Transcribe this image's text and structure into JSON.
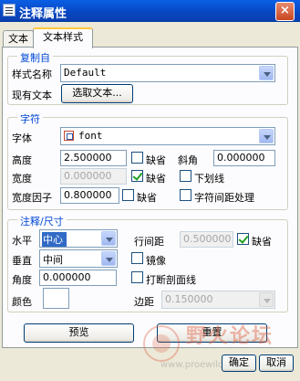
{
  "window": {
    "title": "注释属性",
    "close_symbol": "×"
  },
  "tabs": [
    {
      "label": "文本"
    },
    {
      "label": "文本样式"
    }
  ],
  "copy_from": {
    "group_title": "复制自",
    "style_name_label": "样式名称",
    "style_name_value": "Default",
    "existing_text_label": "现有文本",
    "select_text_button": "选取文本..."
  },
  "character": {
    "group_title": "字符",
    "font_label": "字体",
    "font_value": "font",
    "height_label": "高度",
    "height_value": "2.500000",
    "height_default_label": "缺省",
    "height_default_checked": false,
    "slant_label": "斜角",
    "slant_value": "0.000000",
    "width_label": "宽度",
    "width_value": "0.000000",
    "width_default_label": "缺省",
    "width_default_checked": true,
    "underline_label": "下划线",
    "underline_checked": false,
    "width_factor_label": "宽度因子",
    "width_factor_value": "0.800000",
    "width_factor_default_label": "缺省",
    "width_factor_default_checked": false,
    "char_spacing_label": "字符间距处理",
    "char_spacing_checked": false
  },
  "note_dim": {
    "group_title": "注释/尺寸",
    "horizontal_label": "水平",
    "horizontal_value": "中心",
    "vertical_label": "垂直",
    "vertical_value": "中间",
    "angle_label": "角度",
    "angle_value": "0.000000",
    "color_label": "颜色",
    "color_value": "#FFFFFF",
    "line_spacing_label": "行间距",
    "line_spacing_value": "0.500000",
    "line_spacing_default_label": "缺省",
    "line_spacing_default_checked": true,
    "mirror_label": "镜像",
    "mirror_checked": false,
    "break_hatch_label": "打断剖面线",
    "break_hatch_checked": false,
    "margin_label": "边距",
    "margin_value": "0.150000"
  },
  "buttons": {
    "preview": "预览",
    "reset": "重置",
    "ok": "确定",
    "cancel": "取消"
  },
  "watermark": {
    "text": "野火论坛",
    "url": "www.proewildfire.cn"
  }
}
